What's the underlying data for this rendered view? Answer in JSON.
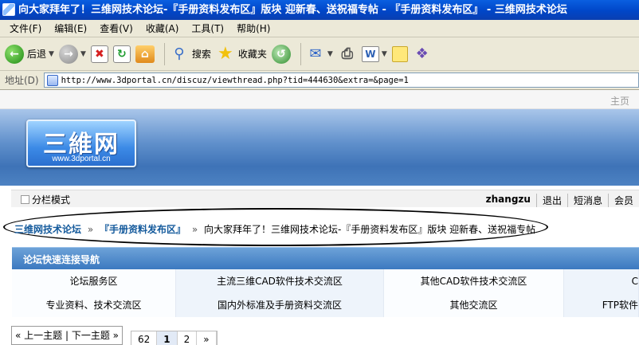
{
  "window": {
    "title": "向大家拜年了！三维网技术论坛-『手册资料发布区』版块 迎新春、送祝福专帖 - 『手册资料发布区』 - 三维网技术论坛"
  },
  "menu": [
    "文件(F)",
    "编辑(E)",
    "查看(V)",
    "收藏(A)",
    "工具(T)",
    "帮助(H)"
  ],
  "toolbar": {
    "back": "后退",
    "search": "搜索",
    "favorites": "收藏夹"
  },
  "address": {
    "label": "地址(D)",
    "url": "http://www.3dportal.cn/discuz/viewthread.php?tid=444630&extra=&page=1"
  },
  "site": {
    "home_link": "主页",
    "logo_text": "三維网",
    "logo_url": "www.3dportal.cn",
    "split_mode": "分栏模式",
    "user": "zhangzu",
    "user_links": [
      "退出",
      "短消息",
      "会员"
    ]
  },
  "breadcrumb": {
    "forum": "三维网技术论坛",
    "board": "『手册资料发布区』",
    "thread": "向大家拜年了！三维网技术论坛-『手册资料发布区』版块 迎新春、送祝福专帖",
    "sep": "»"
  },
  "quicknav": {
    "title": "论坛快速连接导航",
    "rows": [
      [
        "论坛服务区",
        "主流三维CAD软件技术交流区",
        "其他CAD软件技术交流区",
        "C"
      ],
      [
        "专业资料、技术交流区",
        "国内外标准及手册资料交流区",
        "其他交流区",
        "FTP软件"
      ]
    ]
  },
  "pager": {
    "prev_next": "« 上一主题 | 下一主题 »",
    "pages": [
      "62",
      "1",
      "2",
      "»"
    ],
    "current": "1"
  }
}
